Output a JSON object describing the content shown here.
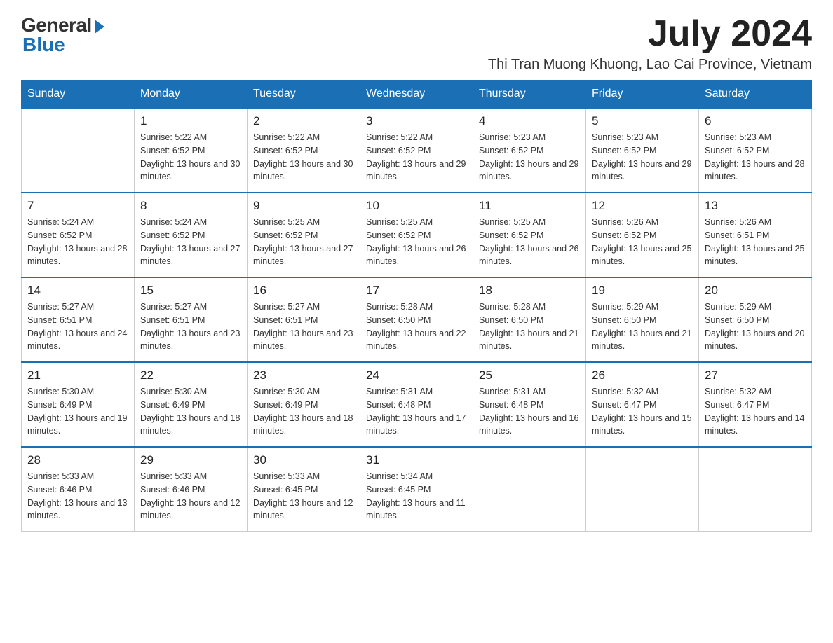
{
  "logo": {
    "general": "General",
    "blue": "Blue"
  },
  "title": {
    "month_year": "July 2024",
    "location": "Thi Tran Muong Khuong, Lao Cai Province, Vietnam"
  },
  "weekdays": [
    "Sunday",
    "Monday",
    "Tuesday",
    "Wednesday",
    "Thursday",
    "Friday",
    "Saturday"
  ],
  "weeks": [
    [
      {
        "day": "",
        "info": ""
      },
      {
        "day": "1",
        "info": "Sunrise: 5:22 AM\nSunset: 6:52 PM\nDaylight: 13 hours and 30 minutes."
      },
      {
        "day": "2",
        "info": "Sunrise: 5:22 AM\nSunset: 6:52 PM\nDaylight: 13 hours and 30 minutes."
      },
      {
        "day": "3",
        "info": "Sunrise: 5:22 AM\nSunset: 6:52 PM\nDaylight: 13 hours and 29 minutes."
      },
      {
        "day": "4",
        "info": "Sunrise: 5:23 AM\nSunset: 6:52 PM\nDaylight: 13 hours and 29 minutes."
      },
      {
        "day": "5",
        "info": "Sunrise: 5:23 AM\nSunset: 6:52 PM\nDaylight: 13 hours and 29 minutes."
      },
      {
        "day": "6",
        "info": "Sunrise: 5:23 AM\nSunset: 6:52 PM\nDaylight: 13 hours and 28 minutes."
      }
    ],
    [
      {
        "day": "7",
        "info": "Sunrise: 5:24 AM\nSunset: 6:52 PM\nDaylight: 13 hours and 28 minutes."
      },
      {
        "day": "8",
        "info": "Sunrise: 5:24 AM\nSunset: 6:52 PM\nDaylight: 13 hours and 27 minutes."
      },
      {
        "day": "9",
        "info": "Sunrise: 5:25 AM\nSunset: 6:52 PM\nDaylight: 13 hours and 27 minutes."
      },
      {
        "day": "10",
        "info": "Sunrise: 5:25 AM\nSunset: 6:52 PM\nDaylight: 13 hours and 26 minutes."
      },
      {
        "day": "11",
        "info": "Sunrise: 5:25 AM\nSunset: 6:52 PM\nDaylight: 13 hours and 26 minutes."
      },
      {
        "day": "12",
        "info": "Sunrise: 5:26 AM\nSunset: 6:52 PM\nDaylight: 13 hours and 25 minutes."
      },
      {
        "day": "13",
        "info": "Sunrise: 5:26 AM\nSunset: 6:51 PM\nDaylight: 13 hours and 25 minutes."
      }
    ],
    [
      {
        "day": "14",
        "info": "Sunrise: 5:27 AM\nSunset: 6:51 PM\nDaylight: 13 hours and 24 minutes."
      },
      {
        "day": "15",
        "info": "Sunrise: 5:27 AM\nSunset: 6:51 PM\nDaylight: 13 hours and 23 minutes."
      },
      {
        "day": "16",
        "info": "Sunrise: 5:27 AM\nSunset: 6:51 PM\nDaylight: 13 hours and 23 minutes."
      },
      {
        "day": "17",
        "info": "Sunrise: 5:28 AM\nSunset: 6:50 PM\nDaylight: 13 hours and 22 minutes."
      },
      {
        "day": "18",
        "info": "Sunrise: 5:28 AM\nSunset: 6:50 PM\nDaylight: 13 hours and 21 minutes."
      },
      {
        "day": "19",
        "info": "Sunrise: 5:29 AM\nSunset: 6:50 PM\nDaylight: 13 hours and 21 minutes."
      },
      {
        "day": "20",
        "info": "Sunrise: 5:29 AM\nSunset: 6:50 PM\nDaylight: 13 hours and 20 minutes."
      }
    ],
    [
      {
        "day": "21",
        "info": "Sunrise: 5:30 AM\nSunset: 6:49 PM\nDaylight: 13 hours and 19 minutes."
      },
      {
        "day": "22",
        "info": "Sunrise: 5:30 AM\nSunset: 6:49 PM\nDaylight: 13 hours and 18 minutes."
      },
      {
        "day": "23",
        "info": "Sunrise: 5:30 AM\nSunset: 6:49 PM\nDaylight: 13 hours and 18 minutes."
      },
      {
        "day": "24",
        "info": "Sunrise: 5:31 AM\nSunset: 6:48 PM\nDaylight: 13 hours and 17 minutes."
      },
      {
        "day": "25",
        "info": "Sunrise: 5:31 AM\nSunset: 6:48 PM\nDaylight: 13 hours and 16 minutes."
      },
      {
        "day": "26",
        "info": "Sunrise: 5:32 AM\nSunset: 6:47 PM\nDaylight: 13 hours and 15 minutes."
      },
      {
        "day": "27",
        "info": "Sunrise: 5:32 AM\nSunset: 6:47 PM\nDaylight: 13 hours and 14 minutes."
      }
    ],
    [
      {
        "day": "28",
        "info": "Sunrise: 5:33 AM\nSunset: 6:46 PM\nDaylight: 13 hours and 13 minutes."
      },
      {
        "day": "29",
        "info": "Sunrise: 5:33 AM\nSunset: 6:46 PM\nDaylight: 13 hours and 12 minutes."
      },
      {
        "day": "30",
        "info": "Sunrise: 5:33 AM\nSunset: 6:45 PM\nDaylight: 13 hours and 12 minutes."
      },
      {
        "day": "31",
        "info": "Sunrise: 5:34 AM\nSunset: 6:45 PM\nDaylight: 13 hours and 11 minutes."
      },
      {
        "day": "",
        "info": ""
      },
      {
        "day": "",
        "info": ""
      },
      {
        "day": "",
        "info": ""
      }
    ]
  ]
}
